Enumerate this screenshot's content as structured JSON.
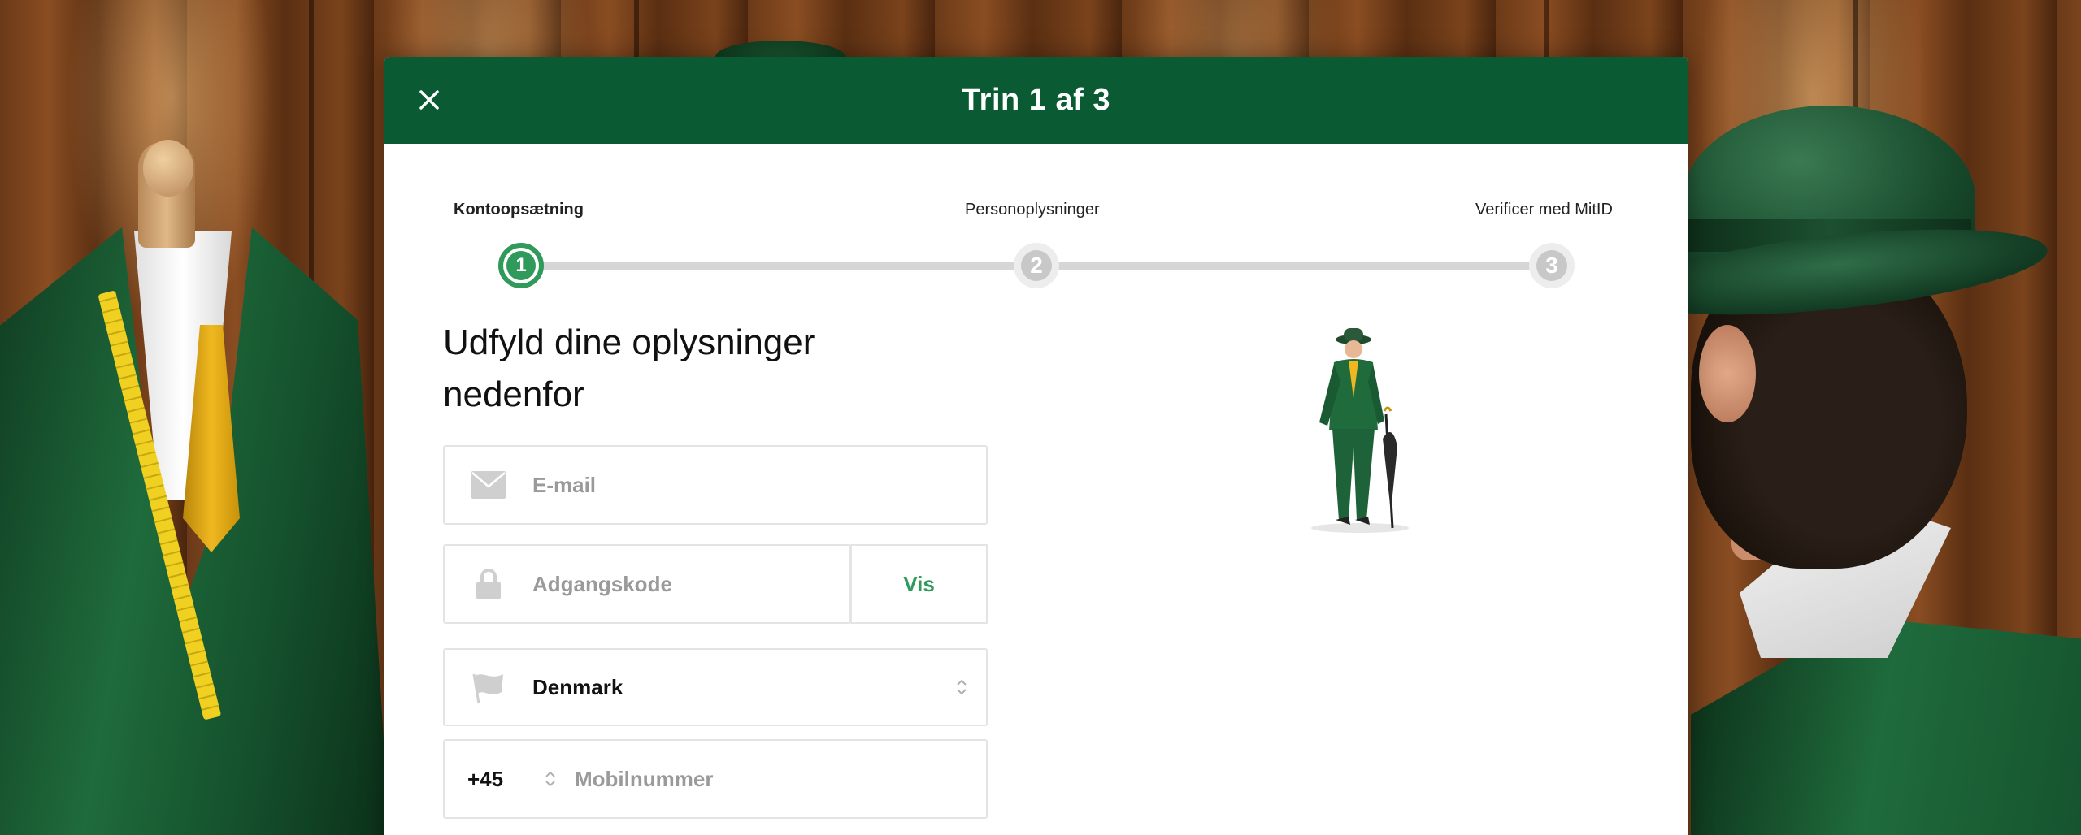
{
  "header": {
    "title": "Trin 1 af 3",
    "close_icon": "close-icon"
  },
  "stepper": {
    "steps": [
      {
        "label": "Kontoopsætning",
        "number": "1",
        "state": "active"
      },
      {
        "label": "Personoplysninger",
        "number": "2",
        "state": "inactive"
      },
      {
        "label": "Verificer med MitID",
        "number": "3",
        "state": "inactive"
      }
    ]
  },
  "form": {
    "heading": "Udfyld dine oplysninger nedenfor",
    "email": {
      "placeholder": "E-mail",
      "value": "",
      "icon": "envelope-icon"
    },
    "password": {
      "placeholder": "Adgangskode",
      "value": "",
      "icon": "lock-icon",
      "show_label": "Vis"
    },
    "country": {
      "value": "Denmark",
      "icon": "flag-icon"
    },
    "phone": {
      "code": "+45",
      "placeholder": "Mobilnummer",
      "value": ""
    }
  },
  "colors": {
    "brand_green": "#0a5a34",
    "accent_green": "#2f9a5a",
    "step_inactive": "#c8c8c8"
  }
}
